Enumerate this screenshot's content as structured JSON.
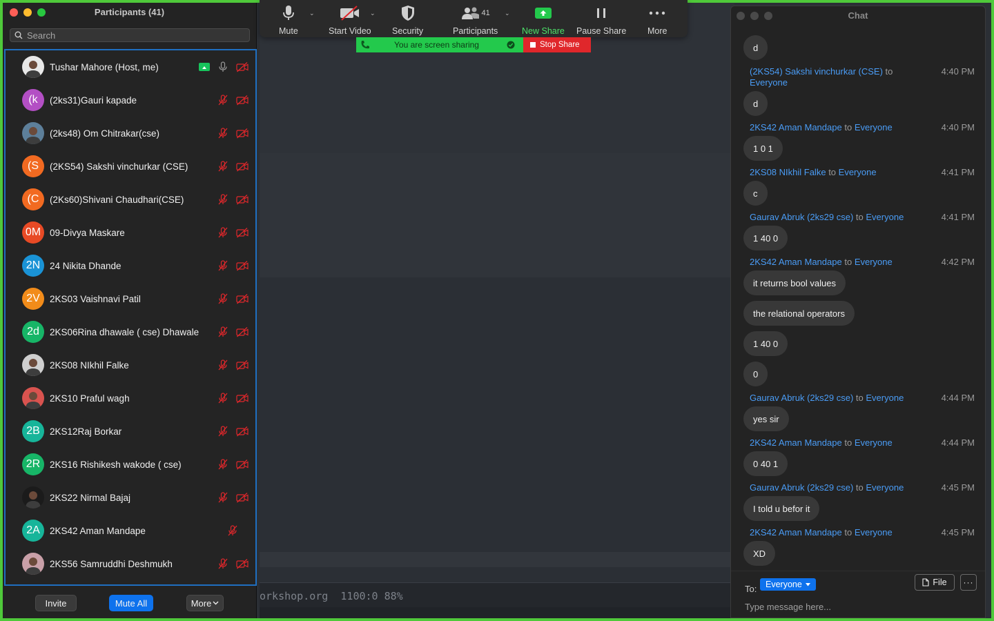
{
  "participants_panel": {
    "title": "Participants (41)",
    "search_placeholder": "Search",
    "rows": [
      {
        "name": "Tushar Mahore (Host, me)",
        "initials": "",
        "avatar_color": "#e8e8e8",
        "photo": true,
        "sharing": true,
        "mic_on": true,
        "video_off": true
      },
      {
        "name": "(2ks31)Gauri kapade",
        "initials": "(k",
        "avatar_color": "#b34fc4",
        "photo": false,
        "sharing": false,
        "mic_on": false,
        "video_off": true
      },
      {
        "name": "(2ks48) Om Chitrakar(cse)",
        "initials": "",
        "avatar_color": "#5d7f9a",
        "photo": true,
        "sharing": false,
        "mic_on": false,
        "video_off": true
      },
      {
        "name": "(2KS54) Sakshi vinchurkar (CSE)",
        "initials": "(S",
        "avatar_color": "#f26a21",
        "photo": false,
        "sharing": false,
        "mic_on": false,
        "video_off": true
      },
      {
        "name": "(2Ks60)Shivani Chaudhari(CSE)",
        "initials": "(C",
        "avatar_color": "#f26a21",
        "photo": false,
        "sharing": false,
        "mic_on": false,
        "video_off": true
      },
      {
        "name": "09-Divya Maskare",
        "initials": "0M",
        "avatar_color": "#e84a25",
        "photo": false,
        "sharing": false,
        "mic_on": false,
        "video_off": true
      },
      {
        "name": "24 Nikita Dhande",
        "initials": "2N",
        "avatar_color": "#1a93d6",
        "photo": false,
        "sharing": false,
        "mic_on": false,
        "video_off": true
      },
      {
        "name": "2KS03 Vaishnavi Patil",
        "initials": "2V",
        "avatar_color": "#f28c1a",
        "photo": false,
        "sharing": false,
        "mic_on": false,
        "video_off": true
      },
      {
        "name": "2KS06Rina dhawale ( cse) Dhawale",
        "initials": "2d",
        "avatar_color": "#17b567",
        "photo": false,
        "sharing": false,
        "mic_on": false,
        "video_off": true
      },
      {
        "name": "2KS08 NIkhil Falke",
        "initials": "",
        "avatar_color": "#cfcfcf",
        "photo": true,
        "sharing": false,
        "mic_on": false,
        "video_off": true
      },
      {
        "name": "2KS10 Praful wagh",
        "initials": "",
        "avatar_color": "#d9534f",
        "photo": true,
        "sharing": false,
        "mic_on": false,
        "video_off": true
      },
      {
        "name": "2KS12Raj Borkar",
        "initials": "2B",
        "avatar_color": "#17b59a",
        "photo": false,
        "sharing": false,
        "mic_on": false,
        "video_off": true
      },
      {
        "name": "2KS16 Rishikesh wakode ( cse)",
        "initials": "2R",
        "avatar_color": "#17b567",
        "photo": false,
        "sharing": false,
        "mic_on": false,
        "video_off": true
      },
      {
        "name": "2KS22 Nirmal Bajaj",
        "initials": "",
        "avatar_color": "#1b1b1b",
        "photo": true,
        "sharing": false,
        "mic_on": false,
        "video_off": true
      },
      {
        "name": "2KS42 Aman Mandape",
        "initials": "2A",
        "avatar_color": "#17b59a",
        "photo": false,
        "sharing": false,
        "mic_on": false,
        "video_off": false
      },
      {
        "name": "2KS56 Samruddhi Deshmukh",
        "initials": "",
        "avatar_color": "#c9a0a8",
        "photo": true,
        "sharing": false,
        "mic_on": false,
        "video_off": true
      }
    ],
    "buttons": {
      "invite": "Invite",
      "mute_all": "Mute All",
      "more": "More"
    }
  },
  "toolbar": {
    "mute": "Mute",
    "start_video": "Start Video",
    "security": "Security",
    "participants": "Participants",
    "participants_count": "41",
    "new_share": "New Share",
    "pause_share": "Pause Share",
    "more": "More",
    "sharing_status": "You are screen sharing",
    "stop_share": "Stop Share"
  },
  "editor": {
    "status_text": "orkshop.org  1100:0 88%"
  },
  "chat": {
    "title": "Chat",
    "messages": [
      {
        "sender": "",
        "to": "",
        "target": "",
        "time": "",
        "bubbles": [
          "d"
        ]
      },
      {
        "sender": "(2KS54) Sakshi vinchurkar (CSE)",
        "to": "to",
        "target": "Everyone",
        "time": "4:40 PM",
        "wrap": true,
        "bubbles": [
          "d"
        ]
      },
      {
        "sender": "2KS42 Aman Mandape",
        "to": "to",
        "target": "Everyone",
        "time": "4:40 PM",
        "bubbles": [
          "1 0 1"
        ]
      },
      {
        "sender": "2KS08 NIkhil Falke",
        "to": "to",
        "target": "Everyone",
        "time": "4:41 PM",
        "bubbles": [
          "c"
        ]
      },
      {
        "sender": "Gaurav Abruk (2ks29 cse)",
        "to": "to",
        "target": "Everyone",
        "time": "4:41 PM",
        "bubbles": [
          "1 40 0"
        ]
      },
      {
        "sender": "2KS42 Aman Mandape",
        "to": "to",
        "target": "Everyone",
        "time": "4:42 PM",
        "bubbles": [
          "it returns bool values",
          "the relational operators",
          "1 40 0",
          "0"
        ]
      },
      {
        "sender": "Gaurav Abruk (2ks29 cse)",
        "to": "to",
        "target": "Everyone",
        "time": "4:44 PM",
        "bubbles": [
          "yes sir"
        ]
      },
      {
        "sender": "2KS42 Aman Mandape",
        "to": "to",
        "target": "Everyone",
        "time": "4:44 PM",
        "bubbles": [
          "0 40 1"
        ]
      },
      {
        "sender": "Gaurav Abruk (2ks29 cse)",
        "to": "to",
        "target": "Everyone",
        "time": "4:45 PM",
        "bubbles": [
          "I told u befor it"
        ]
      },
      {
        "sender": "2KS42 Aman Mandape",
        "to": "to",
        "target": "Everyone",
        "time": "4:45 PM",
        "bubbles": [
          "XD"
        ]
      }
    ],
    "to_label": "To:",
    "recipient": "Everyone",
    "file_button": "File",
    "more_button": "···",
    "input_placeholder": "Type message here..."
  },
  "colors": {
    "frame_green": "#4fc93a",
    "accent_blue": "#0e72ed",
    "share_green": "#23c94c",
    "stop_red": "#e0272b",
    "link_blue": "#4a9cf5"
  }
}
